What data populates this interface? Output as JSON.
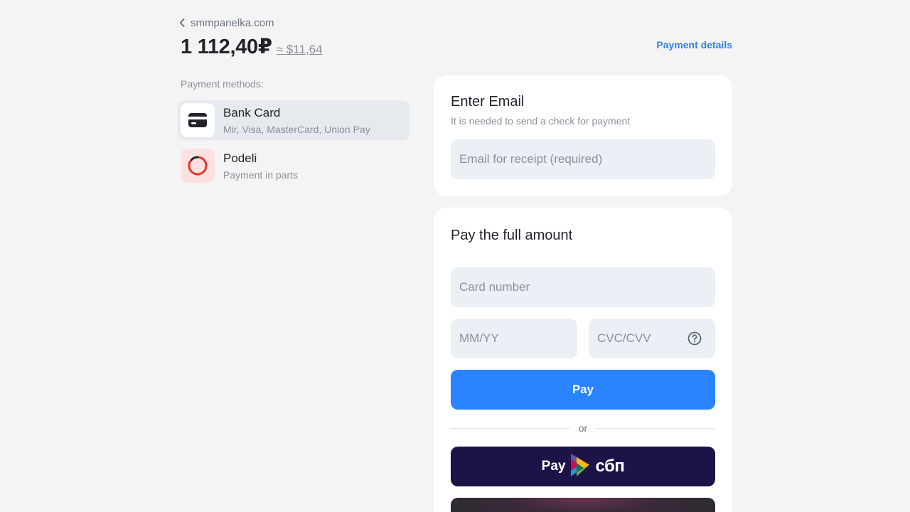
{
  "header": {
    "back_label": "smmpanelka.com",
    "amount": "1 112,40₽",
    "approx_amount": "≈ $11,64",
    "details_link": "Payment details"
  },
  "methods": {
    "label": "Payment methods:",
    "items": [
      {
        "title": "Bank Card",
        "subtitle": "Mir, Visa, MasterCard, Union Pay",
        "icon": "credit-card-icon",
        "selected": true
      },
      {
        "title": "Podeli",
        "subtitle": "Payment in parts",
        "icon": "podeli-ring-icon",
        "selected": false
      }
    ]
  },
  "email_panel": {
    "title": "Enter Email",
    "subtitle": "It is needed to send a check for payment",
    "email_placeholder": "Email for receipt (required)",
    "email_value": ""
  },
  "pay_panel": {
    "title": "Pay the full amount",
    "card_number_placeholder": "Card number",
    "expiry_placeholder": "MM/YY",
    "cvc_placeholder": "CVC/CVV",
    "pay_button": "Pay",
    "divider_text": "or",
    "sbp_pay_label": "Pay",
    "sbp_brand": "сбп"
  },
  "colors": {
    "accent": "#2a84ff",
    "link": "#2f80ed",
    "sbp_bg": "#1d1346",
    "input_bg": "#ebf0f7",
    "podeli_red": "#e8352b"
  }
}
